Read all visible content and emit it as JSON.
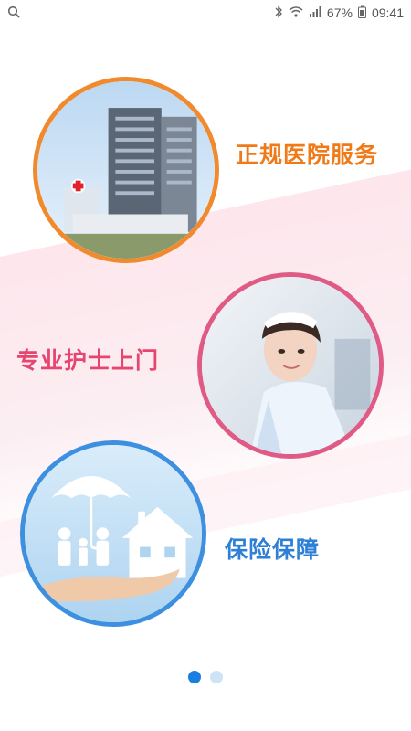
{
  "status_bar": {
    "battery": "67%",
    "time": "09:41"
  },
  "features": [
    {
      "label": "正规医院服务",
      "icon": "hospital-building-image",
      "color": "#f07a18"
    },
    {
      "label": "专业护士上门",
      "icon": "nurse-photo",
      "color": "#e6456f"
    },
    {
      "label": "保险保障",
      "icon": "insurance-umbrella-family-image",
      "color": "#2e7fd6"
    }
  ],
  "pager": {
    "total": 2,
    "current": 1
  }
}
